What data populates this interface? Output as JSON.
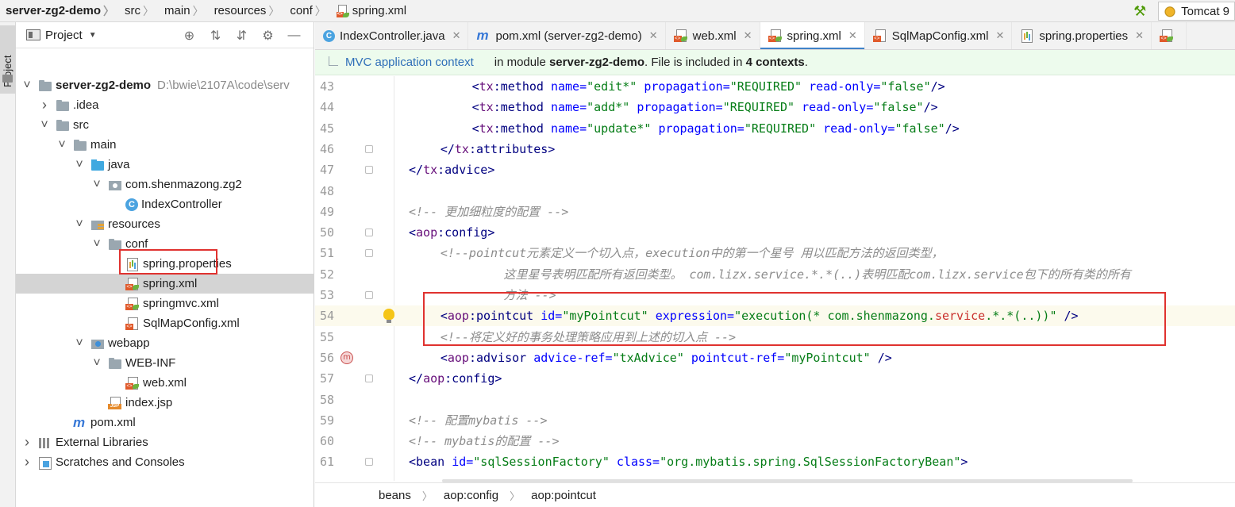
{
  "breadcrumbs": [
    "server-zg2-demo",
    "src",
    "main",
    "resources",
    "conf",
    "spring.xml"
  ],
  "run_config": {
    "label": "Tomcat 9"
  },
  "left_stripe": {
    "project_tab": "Project"
  },
  "project_panel": {
    "title": "Project",
    "header_icons": [
      "target-icon",
      "expand-all-icon",
      "collapse-all-icon",
      "gear-icon",
      "minimize-icon"
    ],
    "tree": [
      {
        "label": "server-zg2-demo",
        "path": "D:\\bwie\\2107A\\code\\serv",
        "icon": "module-folder-icon",
        "depth": 0,
        "expanded": true,
        "bold": true
      },
      {
        "label": ".idea",
        "icon": "folder-icon",
        "depth": 1,
        "expanded": false
      },
      {
        "label": "src",
        "icon": "folder-icon",
        "depth": 1,
        "expanded": true
      },
      {
        "label": "main",
        "icon": "folder-icon",
        "depth": 2,
        "expanded": true
      },
      {
        "label": "java",
        "icon": "source-folder-icon",
        "depth": 3,
        "expanded": true
      },
      {
        "label": "com.shenmazong.zg2",
        "icon": "package-icon",
        "depth": 4,
        "expanded": true
      },
      {
        "label": "IndexController",
        "icon": "class-icon",
        "depth": 5,
        "leaf": true
      },
      {
        "label": "resources",
        "icon": "resources-folder-icon",
        "depth": 3,
        "expanded": true
      },
      {
        "label": "conf",
        "icon": "folder-icon",
        "depth": 4,
        "expanded": true
      },
      {
        "label": "spring.properties",
        "icon": "properties-file-icon",
        "depth": 5,
        "leaf": true
      },
      {
        "label": "spring.xml",
        "icon": "spring-xml-icon",
        "depth": 5,
        "leaf": true,
        "selected": true
      },
      {
        "label": "springmvc.xml",
        "icon": "spring-xml-icon",
        "depth": 5,
        "leaf": true
      },
      {
        "label": "SqlMapConfig.xml",
        "icon": "xml-file-icon",
        "depth": 5,
        "leaf": true
      },
      {
        "label": "webapp",
        "icon": "web-folder-icon",
        "depth": 3,
        "expanded": true
      },
      {
        "label": "WEB-INF",
        "icon": "folder-icon",
        "depth": 4,
        "expanded": true
      },
      {
        "label": "web.xml",
        "icon": "web-xml-icon",
        "depth": 5,
        "leaf": true
      },
      {
        "label": "index.jsp",
        "icon": "jsp-file-icon",
        "depth": 4,
        "leaf": true
      },
      {
        "label": "pom.xml",
        "icon": "maven-icon",
        "depth": 2,
        "leaf": true
      },
      {
        "label": "External Libraries",
        "icon": "libraries-icon",
        "depth": 0,
        "expanded": false
      },
      {
        "label": "Scratches and Consoles",
        "icon": "scratches-icon",
        "depth": 0,
        "expanded": false
      }
    ]
  },
  "editor": {
    "tabs": [
      {
        "label": "IndexController.java",
        "icon": "class-icon",
        "active": false,
        "closable": true
      },
      {
        "label": "pom.xml (server-zg2-demo)",
        "icon": "maven-icon",
        "active": false,
        "closable": true
      },
      {
        "label": "web.xml",
        "icon": "web-xml-icon",
        "active": false,
        "closable": true
      },
      {
        "label": "spring.xml",
        "icon": "spring-xml-icon",
        "active": true,
        "closable": true
      },
      {
        "label": "SqlMapConfig.xml",
        "icon": "xml-file-icon",
        "active": false,
        "closable": true
      },
      {
        "label": "spring.properties",
        "icon": "properties-file-icon",
        "active": false,
        "closable": true
      }
    ],
    "context_bar": {
      "link": "MVC application context",
      "text_pre": "in module ",
      "module": "server-zg2-demo",
      "text_mid": ". File is included in ",
      "contexts": "4 contexts",
      "text_post": "."
    },
    "current_line": 54,
    "lines": [
      {
        "n": 43,
        "indent": 4,
        "tokens": [
          [
            "tag",
            "<"
          ],
          [
            "ns",
            "tx"
          ],
          [
            "tag",
            ":method "
          ],
          [
            "attr",
            "name="
          ],
          [
            "val",
            "\"edit*\""
          ],
          [
            "plain",
            " "
          ],
          [
            "attr",
            "propagation="
          ],
          [
            "val",
            "\"REQUIRED\""
          ],
          [
            "plain",
            " "
          ],
          [
            "attr",
            "read-only="
          ],
          [
            "val",
            "\"false\""
          ],
          [
            "tag",
            "/>"
          ]
        ]
      },
      {
        "n": 44,
        "indent": 4,
        "tokens": [
          [
            "tag",
            "<"
          ],
          [
            "ns",
            "tx"
          ],
          [
            "tag",
            ":method "
          ],
          [
            "attr",
            "name="
          ],
          [
            "val",
            "\"add*\""
          ],
          [
            "plain",
            " "
          ],
          [
            "attr",
            "propagation="
          ],
          [
            "val",
            "\"REQUIRED\""
          ],
          [
            "plain",
            " "
          ],
          [
            "attr",
            "read-only="
          ],
          [
            "val",
            "\"false\""
          ],
          [
            "tag",
            "/>"
          ]
        ]
      },
      {
        "n": 45,
        "indent": 4,
        "tokens": [
          [
            "tag",
            "<"
          ],
          [
            "ns",
            "tx"
          ],
          [
            "tag",
            ":method "
          ],
          [
            "attr",
            "name="
          ],
          [
            "val",
            "\"update*\""
          ],
          [
            "plain",
            " "
          ],
          [
            "attr",
            "propagation="
          ],
          [
            "val",
            "\"REQUIRED\""
          ],
          [
            "plain",
            " "
          ],
          [
            "attr",
            "read-only="
          ],
          [
            "val",
            "\"false\""
          ],
          [
            "tag",
            "/>"
          ]
        ]
      },
      {
        "n": 46,
        "indent": 2,
        "fold": true,
        "tokens": [
          [
            "tag",
            "</"
          ],
          [
            "ns",
            "tx"
          ],
          [
            "tag",
            ":attributes>"
          ]
        ]
      },
      {
        "n": 47,
        "indent": 0,
        "fold": true,
        "tokens": [
          [
            "tag",
            "</"
          ],
          [
            "ns",
            "tx"
          ],
          [
            "tag",
            ":advice>"
          ]
        ]
      },
      {
        "n": 48,
        "indent": 0,
        "tokens": []
      },
      {
        "n": 49,
        "indent": 0,
        "tokens": [
          [
            "cmt",
            "<!-- 更加细粒度的配置 -->"
          ]
        ]
      },
      {
        "n": 50,
        "indent": 0,
        "fold": true,
        "tokens": [
          [
            "tag",
            "<"
          ],
          [
            "ns",
            "aop"
          ],
          [
            "tag",
            ":config>"
          ]
        ]
      },
      {
        "n": 51,
        "indent": 2,
        "fold": true,
        "tokens": [
          [
            "cmt",
            "<!--pointcut元素定义一个切入点，execution中的第一个星号 用以匹配方法的返回类型，"
          ]
        ]
      },
      {
        "n": 52,
        "indent": 6,
        "tokens": [
          [
            "cmt",
            "这里星号表明匹配所有返回类型。 com.lizx.service.*.*(..)表明匹配com.lizx.service包下的所有类的所有"
          ]
        ]
      },
      {
        "n": 53,
        "indent": 6,
        "fold": true,
        "tokens": [
          [
            "cmt",
            "方法 -->"
          ]
        ]
      },
      {
        "n": 54,
        "indent": 2,
        "bulb": true,
        "tokens": [
          [
            "tag",
            "<"
          ],
          [
            "ns",
            "aop"
          ],
          [
            "tag",
            ":pointcut "
          ],
          [
            "attr",
            "id="
          ],
          [
            "val",
            "\"myPointcut\""
          ],
          [
            "plain",
            " "
          ],
          [
            "attr",
            "expression="
          ],
          [
            "val",
            "\"execution(* com.shenmazong."
          ],
          [
            "red",
            "service"
          ],
          [
            "val",
            ".*.*(..))\""
          ],
          [
            "plain",
            " "
          ],
          [
            "tag",
            "/>"
          ]
        ]
      },
      {
        "n": 55,
        "indent": 2,
        "tokens": [
          [
            "cmt",
            "<!--将定义好的事务处理策略应用到上述的切入点 -->"
          ]
        ]
      },
      {
        "n": 56,
        "indent": 2,
        "override": true,
        "tokens": [
          [
            "tag",
            "<"
          ],
          [
            "ns",
            "aop"
          ],
          [
            "tag",
            ":advisor "
          ],
          [
            "attr",
            "advice-ref="
          ],
          [
            "val",
            "\"txAdvice\""
          ],
          [
            "plain",
            " "
          ],
          [
            "attr",
            "pointcut-ref="
          ],
          [
            "val",
            "\"myPointcut\""
          ],
          [
            "plain",
            " "
          ],
          [
            "tag",
            "/>"
          ]
        ]
      },
      {
        "n": 57,
        "indent": 0,
        "fold": true,
        "tokens": [
          [
            "tag",
            "</"
          ],
          [
            "ns",
            "aop"
          ],
          [
            "tag",
            ":config>"
          ]
        ]
      },
      {
        "n": 58,
        "indent": 0,
        "tokens": []
      },
      {
        "n": 59,
        "indent": 0,
        "tokens": [
          [
            "cmt",
            "<!-- 配置mybatis -->"
          ]
        ]
      },
      {
        "n": 60,
        "indent": 0,
        "tokens": [
          [
            "cmt",
            "<!-- mybatis的配置 -->"
          ]
        ]
      },
      {
        "n": 61,
        "indent": 0,
        "fold": true,
        "tokens": [
          [
            "tag",
            "<bean "
          ],
          [
            "attr",
            "id="
          ],
          [
            "val",
            "\"sqlSessionFactory\""
          ],
          [
            "plain",
            " "
          ],
          [
            "attr",
            "class="
          ],
          [
            "val",
            "\"org.mybatis.spring.SqlSessionFactoryBean\""
          ],
          [
            "tag",
            ">"
          ]
        ]
      }
    ],
    "code_breadcrumbs": [
      "beans",
      "aop:config",
      "aop:pointcut"
    ]
  }
}
